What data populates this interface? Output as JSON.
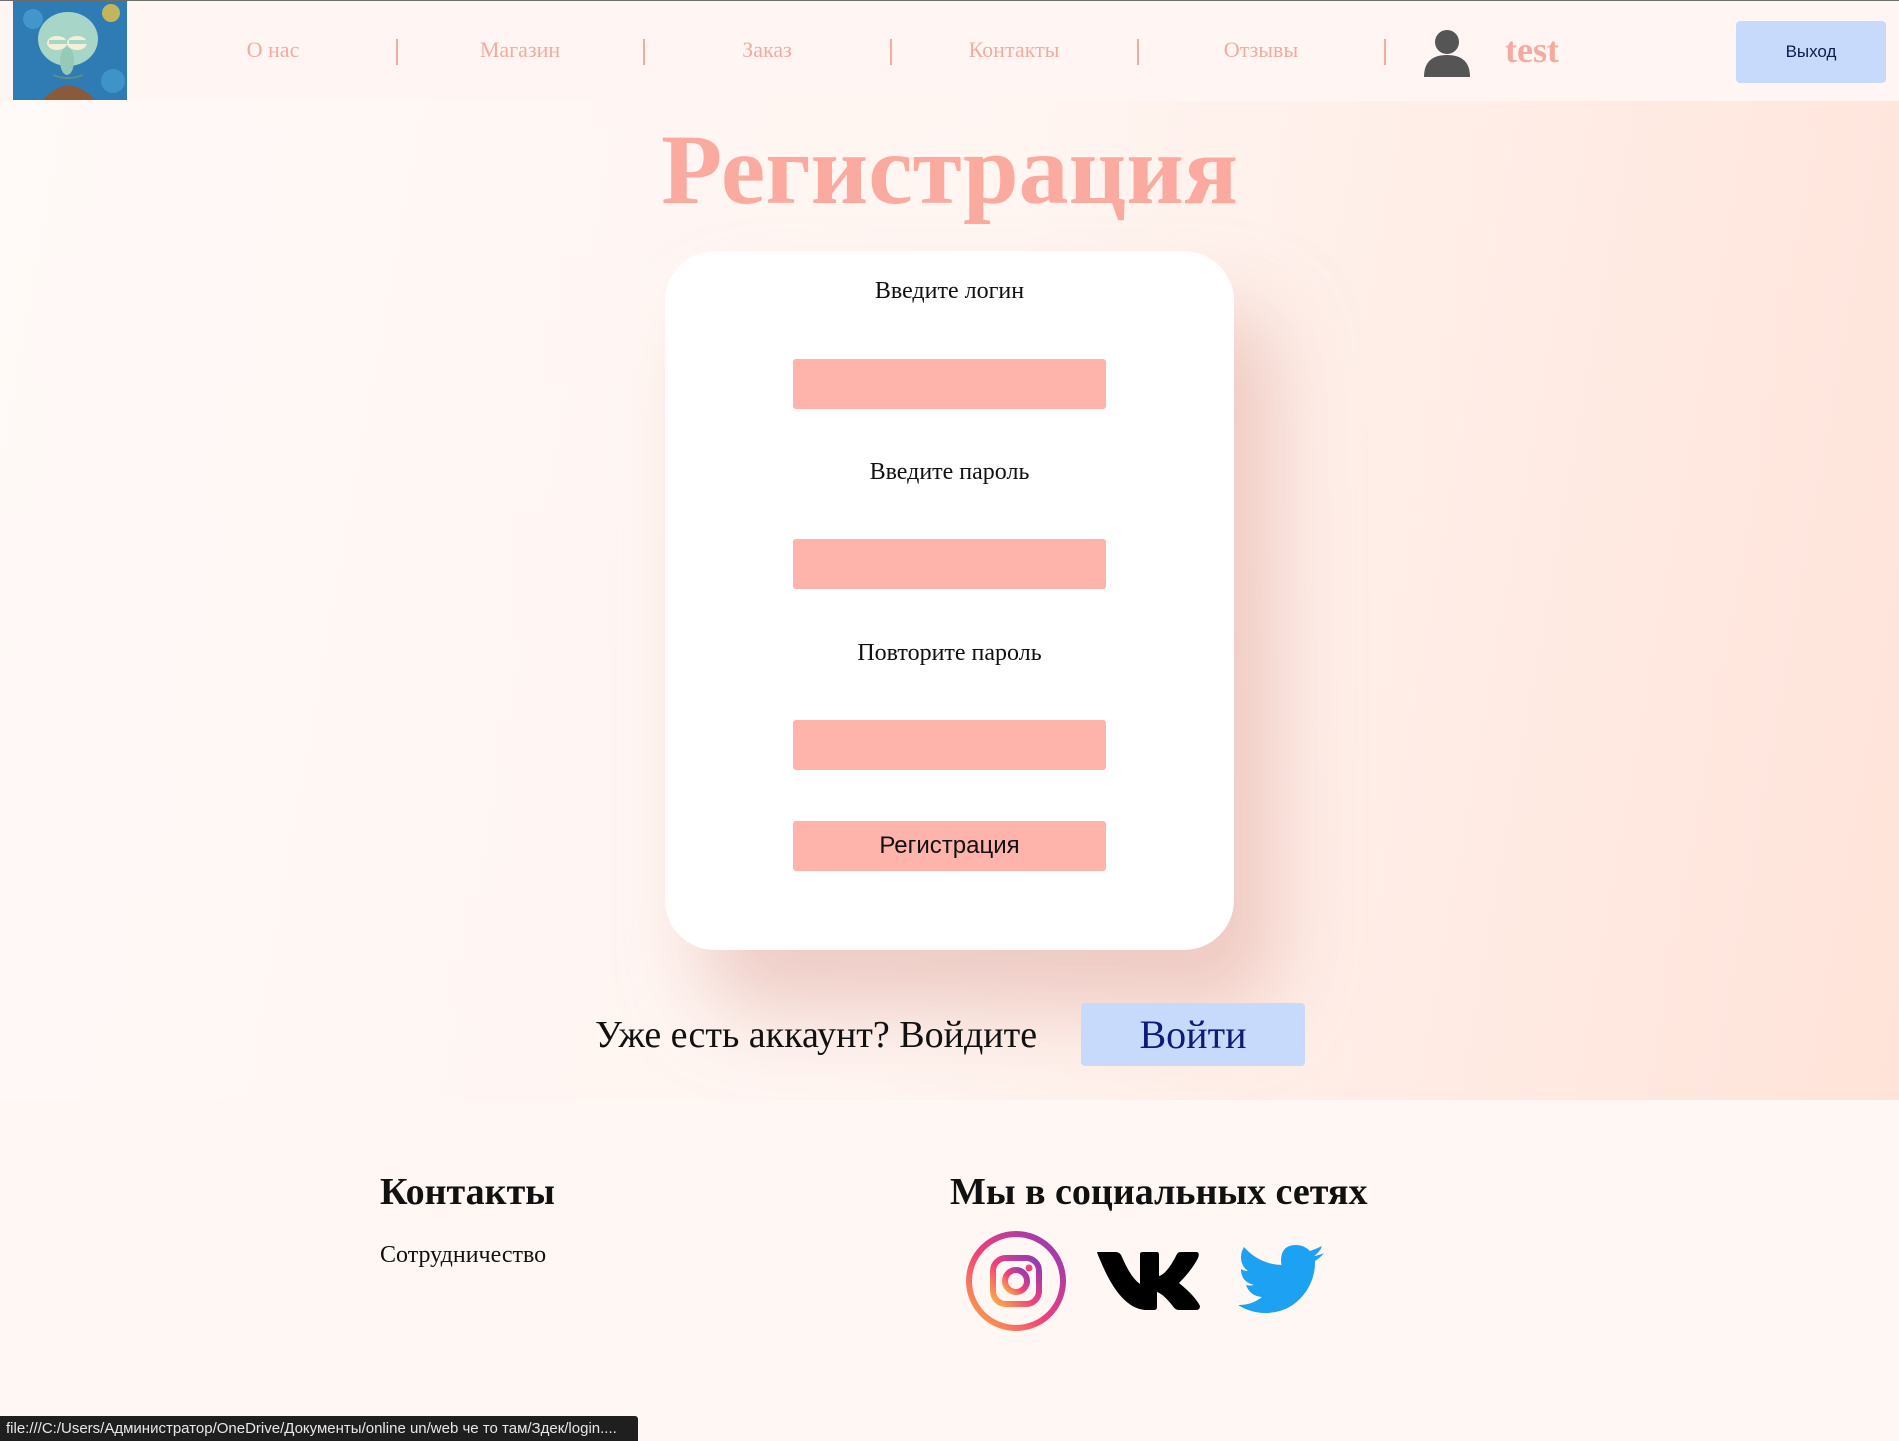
{
  "nav": {
    "items": [
      "О нас",
      "Магазин",
      "Заказ",
      "Контакты",
      "Отзывы"
    ],
    "username": "test",
    "logout_label": "Выход"
  },
  "page": {
    "title": "Регистрация"
  },
  "form": {
    "login_label": "Введите логин",
    "password_label": "Введите пароль",
    "repeat_password_label": "Повторите пароль",
    "submit_label": "Регистрация",
    "login_value": "",
    "password_value": "",
    "repeat_password_value": ""
  },
  "login_prompt": {
    "text": "Уже есть аккаунт? Войдите",
    "button_label": "Войти"
  },
  "footer": {
    "contacts_heading": "Контакты",
    "contacts_link": "Сотрудничество",
    "social_heading": "Мы в социальных сетях",
    "social_icons": [
      "instagram-icon",
      "vk-icon",
      "twitter-icon"
    ]
  },
  "statusbar": {
    "url": "file:///C:/Users/Администратор/OneDrive/Документы/online un/web че то там/Здек/login...."
  },
  "colors": {
    "accent": "#fbaaa0",
    "input_bg": "#feb3ab",
    "button_blue": "#c8dafc",
    "background": "#fff7f4"
  }
}
